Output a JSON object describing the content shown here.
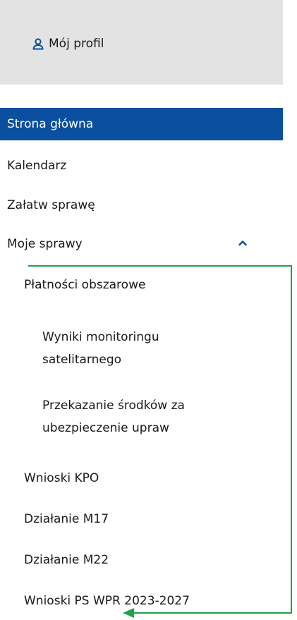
{
  "profile": {
    "label": "Mój profil",
    "icon": "user-icon"
  },
  "nav": {
    "home": "Strona główna",
    "calendar": "Kalendarz",
    "handle_case": "Załatw sprawę",
    "my_cases": "Moje sprawy",
    "area_payments": "Płatności obszarowe",
    "satellite_monitoring": "Wyniki monitoringu satelitarnego",
    "insurance_transfer": "Przekazanie środków za ubezpieczenie upraw",
    "kpo": "Wnioski KPO",
    "m17": "Działanie M17",
    "m22": "Działanie M22",
    "ps_wpr": "Wnioski PS WPR 2023-2027"
  },
  "colors": {
    "active_bg": "#0a4fa0",
    "profile_bg": "#e3e3e3",
    "annotation": "#1fa34a"
  }
}
